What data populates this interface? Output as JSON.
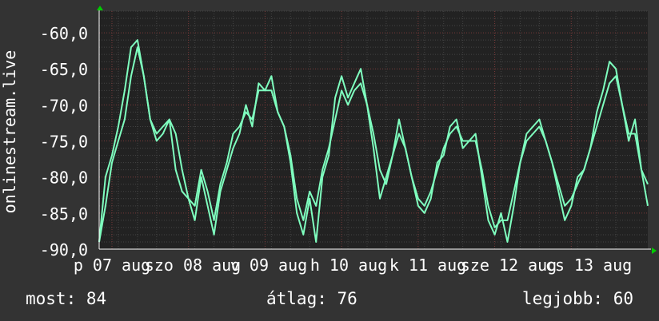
{
  "colors": {
    "background": "#333333",
    "plot_background": "#222222",
    "grid_minor": "#444444",
    "grid_major": "#7a3a3a",
    "line": "#7fffbf",
    "axis_arrow": "#00cc00",
    "text": "#ffffff"
  },
  "chart_data": {
    "type": "line",
    "ylabel": "onlinestream.live",
    "ylim": [
      -90,
      -57
    ],
    "y_ticks": [
      "-60,0",
      "-65,0",
      "-70,0",
      "-75,0",
      "-80,0",
      "-85,0",
      "-90,0"
    ],
    "y_tick_values": [
      -60,
      -65,
      -70,
      -75,
      -80,
      -85,
      -90
    ],
    "x_tick_labels": [
      "p 07 aug",
      "szo 08 aug",
      "v 09 aug",
      "h 10 aug",
      "k 11 aug",
      "sze 12 aug",
      "cs 13 aug"
    ],
    "x": [
      0,
      0.083,
      0.167,
      0.25,
      0.333,
      0.417,
      0.5,
      0.583,
      0.667,
      0.75,
      0.833,
      0.917,
      1,
      1.083,
      1.167,
      1.25,
      1.333,
      1.417,
      1.5,
      1.583,
      1.667,
      1.75,
      1.833,
      1.917,
      2,
      2.083,
      2.167,
      2.25,
      2.333,
      2.417,
      2.5,
      2.583,
      2.667,
      2.75,
      2.833,
      2.917,
      3,
      3.083,
      3.167,
      3.25,
      3.333,
      3.417,
      3.5,
      3.583,
      3.667,
      3.75,
      3.833,
      3.917,
      4,
      4.083,
      4.167,
      4.25,
      4.333,
      4.417,
      4.5,
      4.583,
      4.667,
      4.75,
      4.833,
      4.917,
      5,
      5.083,
      5.167,
      5.25,
      5.333,
      5.417,
      5.5,
      5.583,
      5.667,
      5.75,
      5.833,
      5.917,
      6,
      6.083,
      6.167,
      6.25,
      6.333,
      6.417,
      6.5,
      6.583,
      6.667,
      6.75,
      6.833,
      6.917,
      7,
      7.083,
      7.167
    ],
    "series": [
      {
        "values": [
          -89,
          -80,
          -77,
          -73,
          -68,
          -62,
          -61,
          -66,
          -72,
          -75,
          -74,
          -72,
          -79,
          -82,
          -83,
          -86,
          -80,
          -84,
          -88,
          -82,
          -79,
          -76,
          -74,
          -70,
          -73,
          -67,
          -68,
          -66,
          -71,
          -73,
          -78,
          -85,
          -88,
          -83,
          -89,
          -80,
          -77,
          -69,
          -66,
          -69,
          -67,
          -65,
          -70,
          -76,
          -83,
          -80,
          -77,
          -72,
          -76,
          -80,
          -84,
          -85,
          -83,
          -78,
          -77,
          -73,
          -72,
          -76,
          -75,
          -74,
          -80,
          -86,
          -88,
          -85,
          -89,
          -84,
          -78,
          -74,
          -73,
          -72,
          -75,
          -78,
          -82,
          -86,
          -84,
          -80,
          -79,
          -76,
          -71,
          -68,
          -64,
          -65,
          -70,
          -75,
          -72,
          -79,
          -81
        ]
      },
      {
        "values": [
          -89,
          -84,
          -78,
          -75,
          -72,
          -66,
          -62,
          -66,
          -72,
          -74,
          -73,
          -72,
          -74,
          -79,
          -83,
          -84,
          -79,
          -82,
          -86,
          -81,
          -78,
          -74,
          -73,
          -71,
          -72,
          -68,
          -68,
          -68,
          -71,
          -73,
          -77,
          -83,
          -86,
          -82,
          -84,
          -79,
          -76,
          -72,
          -68,
          -70,
          -68,
          -67,
          -70,
          -74,
          -79,
          -81,
          -77,
          -74,
          -76,
          -80,
          -83,
          -84,
          -82,
          -79,
          -76,
          -74,
          -73,
          -75,
          -75,
          -75,
          -79,
          -84,
          -87,
          -86,
          -86,
          -82,
          -78,
          -75,
          -74,
          -73,
          -75,
          -78,
          -81,
          -84,
          -83,
          -81,
          -79,
          -76,
          -73,
          -70,
          -67,
          -66,
          -70,
          -74,
          -74,
          -79,
          -84
        ]
      }
    ]
  },
  "stats": {
    "now": "most: 84",
    "avg": "átlag: 76",
    "best": "legjobb: 60"
  }
}
